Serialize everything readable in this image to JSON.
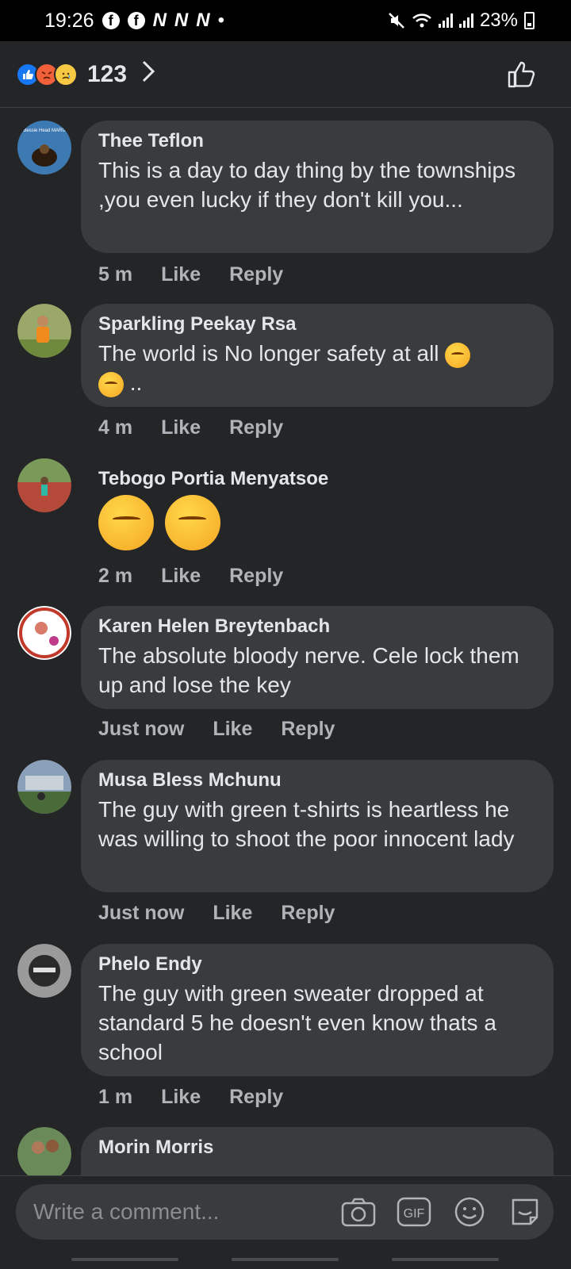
{
  "status_bar": {
    "time": "19:26",
    "battery": "23%",
    "icons": [
      "facebook-icon",
      "facebook-icon",
      "n-icon",
      "n-icon",
      "n-icon",
      "mute-icon",
      "wifi-icon",
      "signal-icon",
      "signal-icon",
      "battery-icon"
    ]
  },
  "reactions": {
    "count": "123",
    "types": [
      "like",
      "angry",
      "sad"
    ]
  },
  "comments": [
    {
      "author": "Thee Teflon",
      "text": "This is a day to day thing by the townships ,you even lucky if they don't kill you...",
      "time": "5 m",
      "like": "Like",
      "reply": "Reply",
      "avatar_text": "Bessie Head MARU"
    },
    {
      "author": "Sparkling Peekay Rsa",
      "text": "The world is No longer safety at all",
      "text_tail": "..",
      "time": "4 m",
      "like": "Like",
      "reply": "Reply"
    },
    {
      "author": "Tebogo Portia Menyatsoe",
      "text": "",
      "time": "2 m",
      "like": "Like",
      "reply": "Reply"
    },
    {
      "author": "Karen Helen Breytenbach",
      "text": "The absolute bloody nerve. Cele lock them up and lose the key",
      "time": "Just now",
      "like": "Like",
      "reply": "Reply"
    },
    {
      "author": "Musa Bless Mchunu",
      "text": "The guy with green t-shirts is heartless he was willing to  shoot the poor innocent lady",
      "time": "Just now",
      "like": "Like",
      "reply": "Reply"
    },
    {
      "author": "Phelo Endy",
      "text": "The guy with green sweater dropped at standard 5 he doesn't even know thats a school",
      "time": "1 m",
      "like": "Like",
      "reply": "Reply"
    },
    {
      "author": "Morin Morris",
      "text": "",
      "time": "",
      "like": "",
      "reply": ""
    }
  ],
  "composer": {
    "placeholder": "Write a comment...",
    "gif_label": "GIF"
  }
}
